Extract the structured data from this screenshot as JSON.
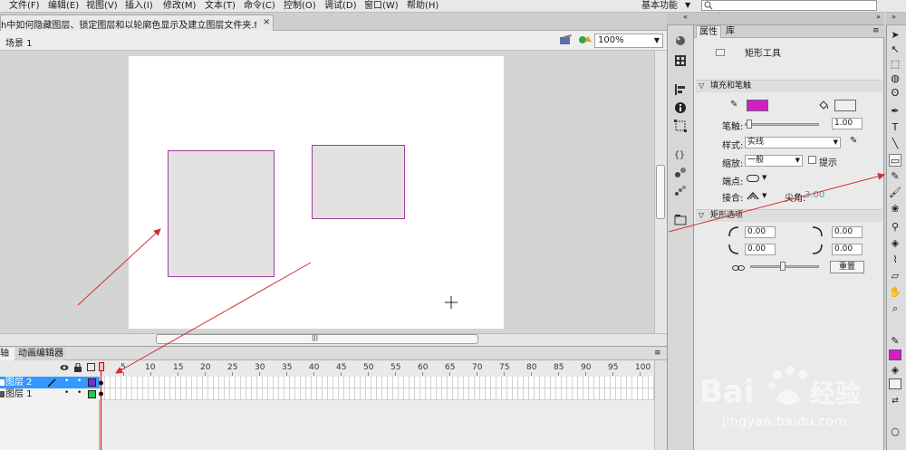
{
  "menu": {
    "items": [
      "文件(F)",
      "编辑(E)",
      "视图(V)",
      "插入(I)",
      "修改(M)",
      "文本(T)",
      "命令(C)",
      "控制(O)",
      "调试(D)",
      "窗口(W)",
      "帮助(H)"
    ],
    "workspace": "基本功能"
  },
  "document": {
    "tab_title": "h中如何隐藏图层、锁定图层和以轮廓色显示及建立图层文件夹.fla*",
    "close": "×"
  },
  "scene": {
    "label": "场景 1",
    "zoom": "100%"
  },
  "timeline": {
    "tab_timeline": "轴",
    "tab_motion_editor": "动画编辑器",
    "frame_numbers": [
      "5",
      "10",
      "15",
      "20",
      "25",
      "30",
      "35",
      "40",
      "45",
      "50",
      "55",
      "60",
      "65",
      "70",
      "75",
      "80",
      "85",
      "90",
      "95",
      "100"
    ],
    "layers": [
      {
        "name": "图层 2",
        "selected": true,
        "color": "#7b2fd0"
      },
      {
        "name": "图层 1",
        "selected": false,
        "color": "#22cc44"
      }
    ]
  },
  "properties": {
    "tab_properties": "属性",
    "tab_library": "库",
    "tool_name": "矩形工具",
    "fill_stroke_section": "填充和笔触",
    "stroke_color": "#d21ec8",
    "fill_color": "#eeeeee",
    "stroke_label": "笔触:",
    "stroke_value": "1.00",
    "style_label": "样式:",
    "style_value": "实线",
    "scale_label": "缩放:",
    "scale_value": "一般",
    "hint_label": "提示",
    "cap_label": "端点:",
    "join_label": "接合:",
    "miter_label": "尖角:",
    "miter_value": "3.00",
    "rect_options_section": "矩形选项",
    "corner_radius": [
      "0.00",
      "0.00",
      "0.00",
      "0.00"
    ],
    "reset_label": "重置"
  },
  "canvas": {
    "rect_stroke_color": "#a03ca0",
    "rect_fill_color": "#e4e1e3"
  },
  "annotation_color": "#d03030",
  "watermark": {
    "logo": "Baidu经验",
    "url": "jingyan.baidu.com"
  }
}
